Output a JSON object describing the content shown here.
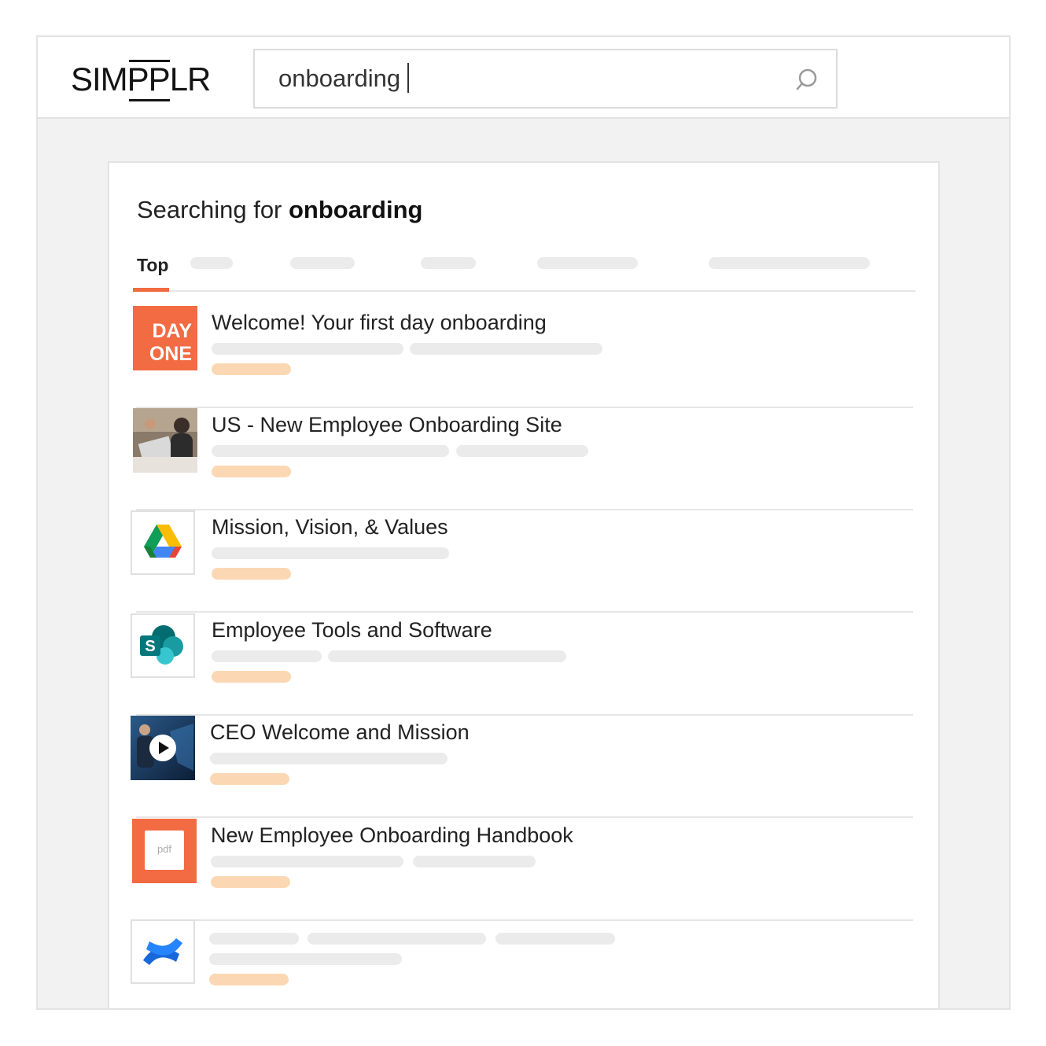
{
  "brand": {
    "logo_left": "SIM",
    "logo_mid": "PP",
    "logo_right": "LR"
  },
  "search": {
    "value": "onboarding",
    "icon": "search-icon"
  },
  "results_header": {
    "prefix": "Searching for ",
    "query": "onboarding"
  },
  "tabs": {
    "active_label": "Top"
  },
  "results": [
    {
      "title": "Welcome! Your first day onboarding",
      "thumb_type": "day-one",
      "thumb_text_1": "DAY",
      "thumb_text_2": "ONE"
    },
    {
      "title": "US - New Employee Onboarding Site",
      "thumb_type": "photo"
    },
    {
      "title": "Mission, Vision, & Values",
      "thumb_type": "google-drive-icon"
    },
    {
      "title": "Employee Tools and Software",
      "thumb_type": "sharepoint-icon",
      "thumb_text_1": "S"
    },
    {
      "title": "CEO Welcome and Mission",
      "thumb_type": "video"
    },
    {
      "title": "New Employee Onboarding Handbook",
      "thumb_type": "pdf-icon",
      "thumb_text_1": "pdf"
    },
    {
      "title": "",
      "thumb_type": "confluence-icon"
    }
  ],
  "colors": {
    "accent": "#f26b43",
    "placeholder_bar": "#ebebeb",
    "placeholder_tag": "#fbd8b3"
  }
}
